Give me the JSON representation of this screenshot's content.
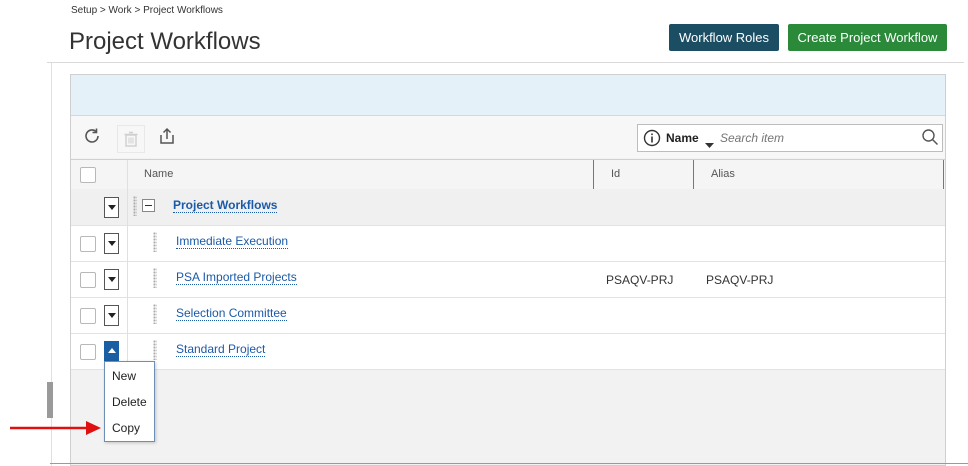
{
  "breadcrumb": "Setup > Work > Project Workflows",
  "page_title": "Project Workflows",
  "buttons": {
    "workflow_roles": "Workflow Roles",
    "create": "Create Project Workflow"
  },
  "search": {
    "field": "Name",
    "placeholder": "Search item"
  },
  "columns": {
    "name": "Name",
    "id": "Id",
    "alias": "Alias"
  },
  "rows": [
    {
      "name": "Project Workflows",
      "id": "",
      "alias": ""
    },
    {
      "name": "Immediate Execution",
      "id": "",
      "alias": ""
    },
    {
      "name": "PSA Imported Projects",
      "id": "PSAQV-PRJ",
      "alias": "PSAQV-PRJ"
    },
    {
      "name": "Selection Committee",
      "id": "",
      "alias": ""
    },
    {
      "name": "Standard Project",
      "id": "",
      "alias": ""
    }
  ],
  "context_menu": {
    "new": "New",
    "delete": "Delete",
    "copy": "Copy"
  },
  "colors": {
    "accent_dark": "#1c4e63",
    "accent_green": "#2a8a3a",
    "link": "#1b5aa8",
    "arrow": "#e01010"
  }
}
